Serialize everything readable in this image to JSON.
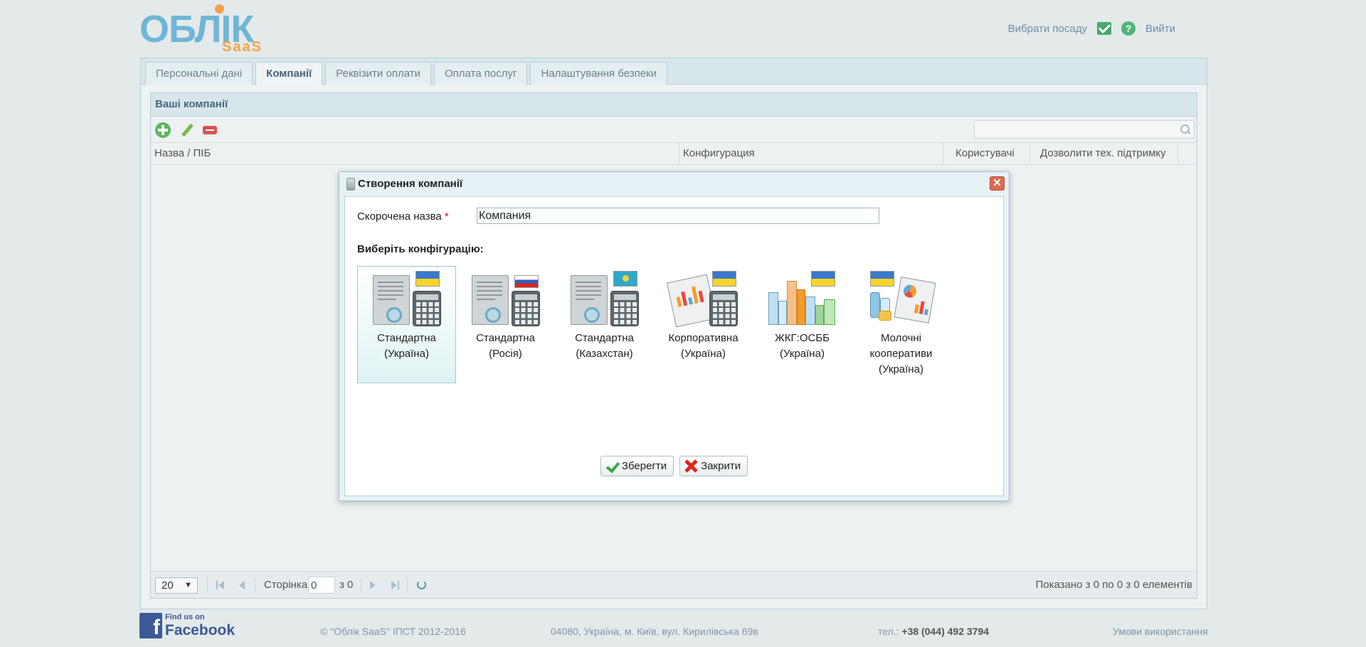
{
  "header": {
    "logo_main": "ОБЛ",
    "logo_rest": "ІК",
    "logo_sub": "SaaS",
    "choose_position": "Вибрати посаду",
    "logout": "Вийти"
  },
  "tabs": [
    {
      "label": "Персональні дані",
      "active": false
    },
    {
      "label": "Компанії",
      "active": true
    },
    {
      "label": "Реквізити оплати",
      "active": false
    },
    {
      "label": "Оплата послуг",
      "active": false
    },
    {
      "label": "Налаштування безпеки",
      "active": false
    }
  ],
  "grid": {
    "title": "Ваші компанії",
    "search_placeholder": "",
    "columns": [
      "Назва / ПІБ",
      "Конфигурация",
      "Користувачі",
      "Дозволити тех. підтримку"
    ],
    "rows": []
  },
  "pager": {
    "page_size": "20",
    "page_label": "Сторінка",
    "page_value": "0",
    "of_label": "з 0",
    "info": "Показано з 0 по 0 з 0 елементів"
  },
  "modal": {
    "title": "Створення компанії",
    "short_name_label": "Скорочена назва",
    "required_mark": "*",
    "short_name_value": "Компания",
    "config_heading": "Виберіть конфігурацію:",
    "configs": [
      {
        "line1": "Стандартна",
        "line2": "(Україна)",
        "line3": "",
        "selected": true,
        "icon": "standard-ukraine-icon"
      },
      {
        "line1": "Стандартна",
        "line2": "(Росія)",
        "line3": "",
        "selected": false,
        "icon": "standard-russia-icon"
      },
      {
        "line1": "Стандартна",
        "line2": "(Казахстан)",
        "line3": "",
        "selected": false,
        "icon": "standard-kazakhstan-icon"
      },
      {
        "line1": "Корпоративна",
        "line2": "(Україна)",
        "line3": "",
        "selected": false,
        "icon": "corporate-ukraine-icon"
      },
      {
        "line1": "ЖКГ:ОСББ",
        "line2": "(Україна)",
        "line3": "",
        "selected": false,
        "icon": "housing-ukraine-icon"
      },
      {
        "line1": "Молочні",
        "line2": "кооперативи",
        "line3": "(Україна)",
        "selected": false,
        "icon": "dairy-ukraine-icon"
      }
    ],
    "save_label": "Зберегти",
    "close_label": "Закрити"
  },
  "footer": {
    "fb_small": "Find us on",
    "fb_big": "Facebook",
    "copyright": "© \"Облік SaaS\" ІПСТ 2012-2016",
    "address": "04080, Україна, м. Київ, вул. Кирилівська 69в",
    "phone_label": "тел.:",
    "phone": "+38 (044) 492 3794",
    "terms": "Умови використання"
  },
  "colors": {
    "accent": "#6fb6d6",
    "logo_orange": "#f2a34a",
    "tab_bg": "#d6e6ea",
    "selected_config_bg": "#dff3f4"
  }
}
